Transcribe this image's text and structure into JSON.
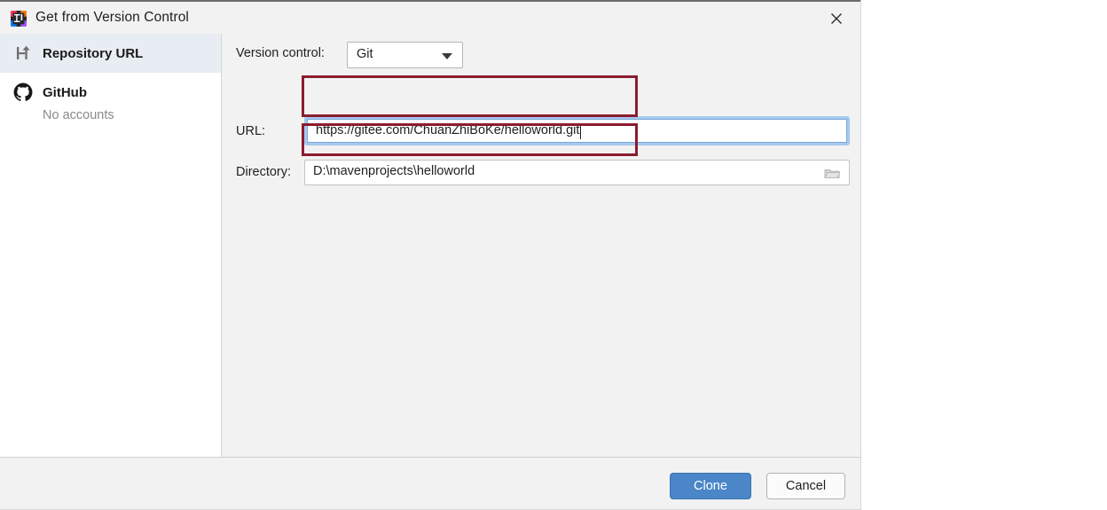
{
  "window": {
    "title": "Get from Version Control",
    "app_icon": "intellij-idea-icon",
    "close_label": "×"
  },
  "sidebar": {
    "items": [
      {
        "label": "Repository URL",
        "icon": "vcs-branch-icon",
        "selected": true,
        "sub": ""
      },
      {
        "label": "GitHub",
        "icon": "github-icon",
        "selected": false,
        "sub": "No accounts"
      }
    ]
  },
  "form": {
    "version_control": {
      "label": "Version control:",
      "value": "Git",
      "arrow_icon": "chevron-down-icon"
    },
    "url": {
      "label": "URL:",
      "value": "https://gitee.com/ChuanZhiBoKe/helloworld.git",
      "placeholder": "",
      "focused": true
    },
    "directory": {
      "label": "Directory:",
      "value": "D:\\mavenprojects\\helloworld",
      "placeholder": "",
      "browse_icon": "folder-icon"
    }
  },
  "footer": {
    "clone_label": "Clone",
    "cancel_label": "Cancel"
  },
  "annotations": [
    {
      "name": "url-highlight",
      "color": "#8b1c2e"
    },
    {
      "name": "directory-highlight",
      "color": "#8b1c2e"
    }
  ],
  "colors": {
    "accent": "#4a86c8",
    "dialog_bg": "#f2f2f2",
    "sidebar_bg": "#ffffff",
    "selected_row": "#e8edf3",
    "annotation": "#8b1c2e",
    "focus_ring": "#a7c9ee"
  }
}
